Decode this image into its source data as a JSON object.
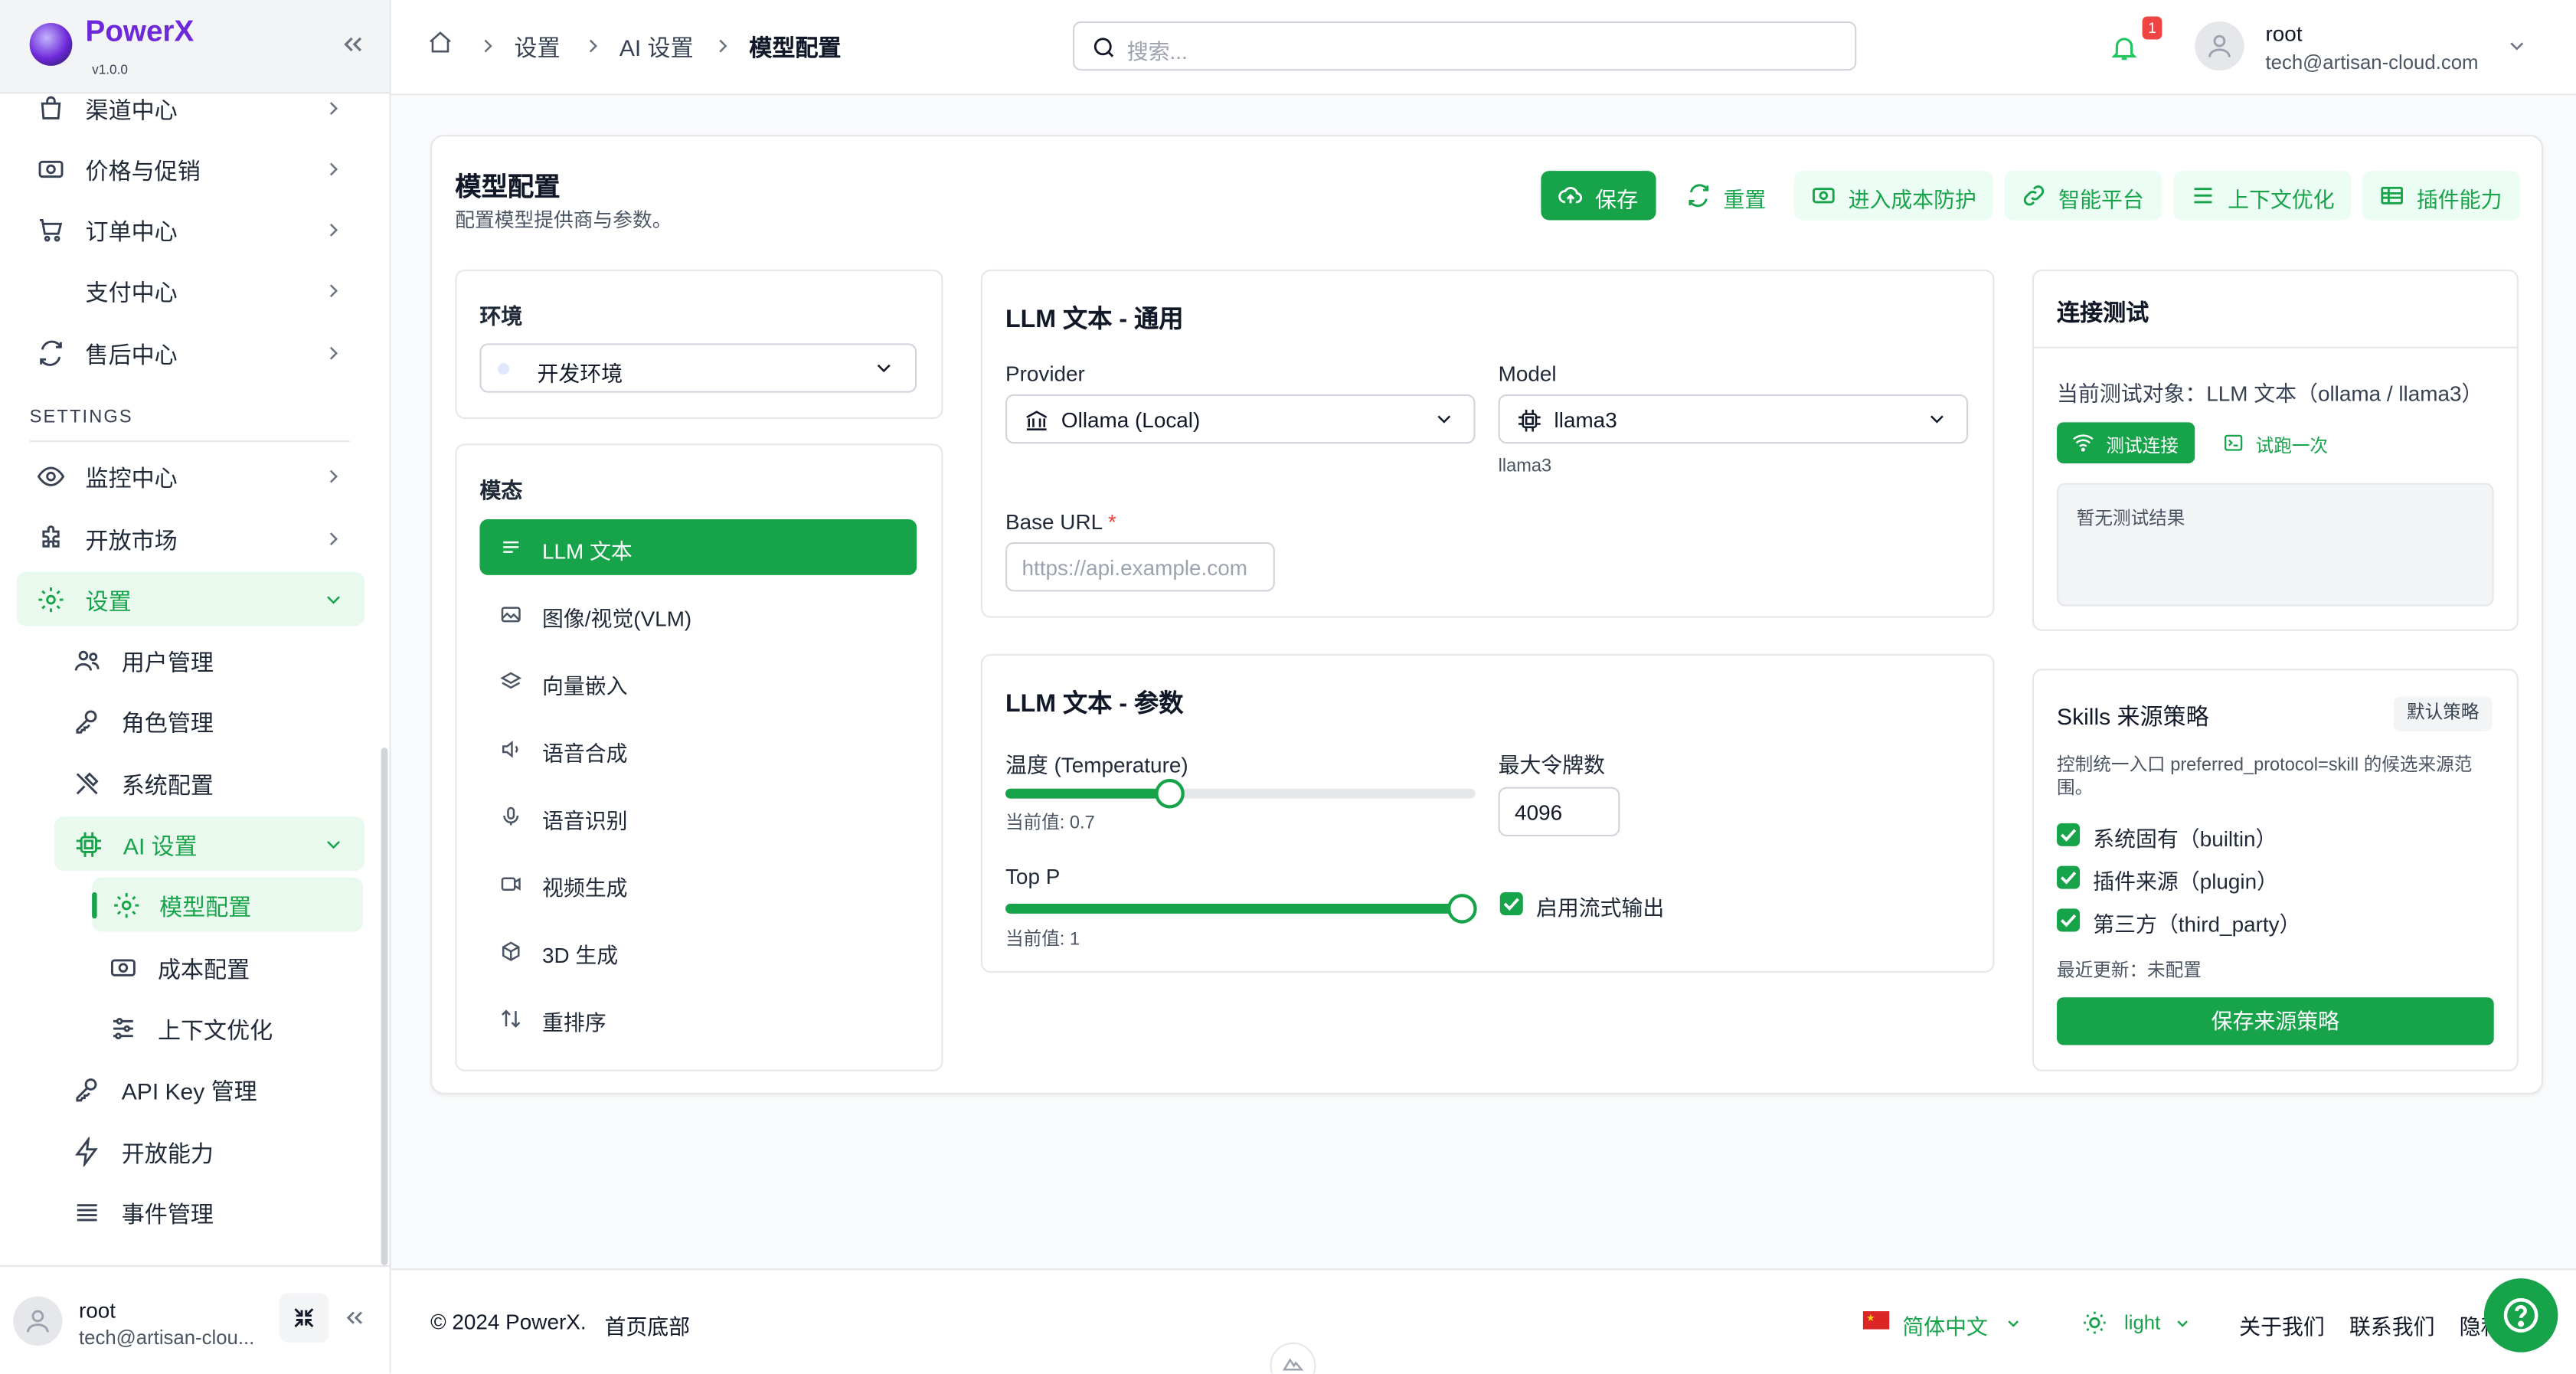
{
  "brand": {
    "name": "PowerX",
    "version": "v1.0.0"
  },
  "sidebar": {
    "items_top": [
      {
        "label": "渠道中心",
        "icon": "bag-icon"
      },
      {
        "label": "价格与促销",
        "icon": "price-icon"
      },
      {
        "label": "订单中心",
        "icon": "cart-icon"
      },
      {
        "label": "支付中心",
        "icon": ""
      },
      {
        "label": "售后中心",
        "icon": "refresh-icon"
      }
    ],
    "section_label": "SETTINGS",
    "items_settings": [
      {
        "label": "监控中心",
        "icon": "eye-icon"
      },
      {
        "label": "开放市场",
        "icon": "puzzle-icon"
      },
      {
        "label": "设置",
        "icon": "gear-icon"
      }
    ],
    "settings_children": [
      {
        "label": "用户管理",
        "icon": "users-icon"
      },
      {
        "label": "角色管理",
        "icon": "key-icon"
      },
      {
        "label": "系统配置",
        "icon": "tools-icon"
      },
      {
        "label": "AI 设置",
        "icon": "chip-icon"
      }
    ],
    "ai_children": [
      {
        "label": "模型配置",
        "icon": "gear-icon"
      },
      {
        "label": "成本配置",
        "icon": "money-icon"
      },
      {
        "label": "上下文优化",
        "icon": "sliders-icon"
      }
    ],
    "settings_tail": [
      {
        "label": "API Key 管理",
        "icon": "key-icon"
      },
      {
        "label": "开放能力",
        "icon": "bolt-icon"
      },
      {
        "label": "事件管理",
        "icon": "list-icon"
      }
    ],
    "user": {
      "name": "root",
      "email": "tech@artisan-clou..."
    }
  },
  "header": {
    "breadcrumb": [
      "设置",
      "AI 设置",
      "模型配置"
    ],
    "search_placeholder": "搜索...",
    "notifications": "1",
    "user": {
      "name": "root",
      "email": "tech@artisan-cloud.com"
    }
  },
  "page": {
    "title": "模型配置",
    "subtitle": "配置模型提供商与参数。",
    "actions": {
      "save": "保存",
      "reset": "重置",
      "cost": "进入成本防护",
      "platform": "智能平台",
      "context": "上下文优化",
      "plugins": "插件能力"
    }
  },
  "env": {
    "label": "环境",
    "value": "开发环境"
  },
  "modes": {
    "label": "模态",
    "items": [
      {
        "label": "LLM 文本",
        "icon": "lines-icon"
      },
      {
        "label": "图像/视觉(VLM)",
        "icon": "image-icon"
      },
      {
        "label": "向量嵌入",
        "icon": "layers-icon"
      },
      {
        "label": "语音合成",
        "icon": "speaker-icon"
      },
      {
        "label": "语音识别",
        "icon": "mic-icon"
      },
      {
        "label": "视频生成",
        "icon": "video-icon"
      },
      {
        "label": "3D 生成",
        "icon": "cube-icon"
      },
      {
        "label": "重排序",
        "icon": "sort-icon"
      }
    ]
  },
  "general": {
    "title": "LLM 文本 - 通用",
    "provider_label": "Provider",
    "provider_value": "Ollama (Local)",
    "model_label": "Model",
    "model_value": "llama3",
    "model_hint": "llama3",
    "base_url_label": "Base URL",
    "required_mark": "*",
    "base_url_placeholder": "https://api.example.com"
  },
  "params": {
    "title": "LLM 文本 - 参数",
    "temperature_label": "温度 (Temperature)",
    "temperature_value_text": "当前值: 0.7",
    "temperature": 0.7,
    "temperature_max": 2,
    "max_tokens_label": "最大令牌数",
    "max_tokens_value": "4096",
    "top_p_label": "Top P",
    "top_p_value_text": "当前值: 1",
    "top_p": 1,
    "stream_label": "启用流式输出",
    "stream_checked": true
  },
  "connection": {
    "title": "连接测试",
    "target": "当前测试对象：LLM 文本（ollama / llama3）",
    "test_button": "测试连接",
    "try_button": "试跑一次",
    "result": "暂无测试结果"
  },
  "skills": {
    "title": "Skills 来源策略",
    "badge": "默认策略",
    "desc": "控制统一入口 preferred_protocol=skill 的候选来源范围。",
    "options": [
      "系统固有（builtin）",
      "插件来源（plugin）",
      "第三方（third_party）"
    ],
    "updated": "最近更新：未配置",
    "save_button": "保存来源策略"
  },
  "footer": {
    "copyright": "© 2024 PowerX.",
    "bottom_link": "首页底部",
    "language": "简体中文",
    "theme": "light",
    "about": "关于我们",
    "contact": "联系我们",
    "privacy": "隐私"
  },
  "colors": {
    "accent": "#16a34a",
    "brand": "#6d28d9",
    "danger": "#ef4444"
  }
}
